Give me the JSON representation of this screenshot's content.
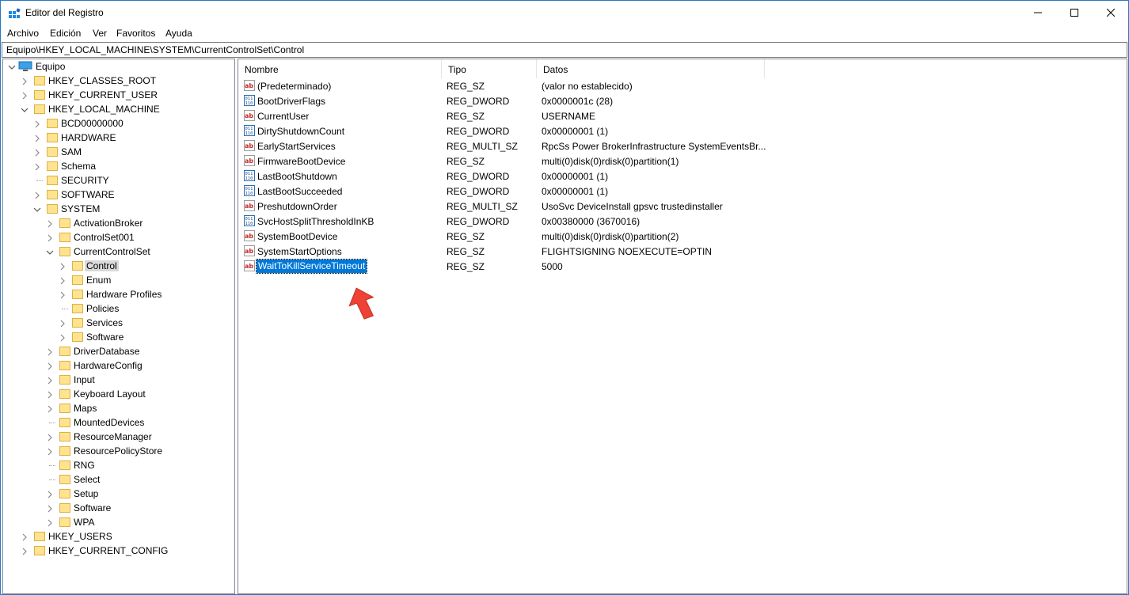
{
  "window": {
    "title": "Editor del Registro",
    "accent_color": "#0078d7"
  },
  "menu": [
    "Archivo",
    "Edición",
    "Ver",
    "Favoritos",
    "Ayuda"
  ],
  "address": "Equipo\\HKEY_LOCAL_MACHINE\\SYSTEM\\CurrentControlSet\\Control",
  "tree": {
    "root": "Equipo",
    "items": [
      {
        "label": "HKEY_CLASSES_ROOT"
      },
      {
        "label": "HKEY_CURRENT_USER"
      },
      {
        "label": "HKEY_LOCAL_MACHINE"
      },
      {
        "label": "BCD00000000"
      },
      {
        "label": "HARDWARE"
      },
      {
        "label": "SAM"
      },
      {
        "label": "Schema"
      },
      {
        "label": "SECURITY"
      },
      {
        "label": "SOFTWARE"
      },
      {
        "label": "SYSTEM"
      },
      {
        "label": "ActivationBroker"
      },
      {
        "label": "ControlSet001"
      },
      {
        "label": "CurrentControlSet"
      },
      {
        "label": "Control"
      },
      {
        "label": "Enum"
      },
      {
        "label": "Hardware Profiles"
      },
      {
        "label": "Policies"
      },
      {
        "label": "Services"
      },
      {
        "label": "Software"
      },
      {
        "label": "DriverDatabase"
      },
      {
        "label": "HardwareConfig"
      },
      {
        "label": "Input"
      },
      {
        "label": "Keyboard Layout"
      },
      {
        "label": "Maps"
      },
      {
        "label": "MountedDevices"
      },
      {
        "label": "ResourceManager"
      },
      {
        "label": "ResourcePolicyStore"
      },
      {
        "label": "RNG"
      },
      {
        "label": "Select"
      },
      {
        "label": "Setup"
      },
      {
        "label": "Software"
      },
      {
        "label": "WPA"
      },
      {
        "label": "HKEY_USERS"
      },
      {
        "label": "HKEY_CURRENT_CONFIG"
      }
    ]
  },
  "list": {
    "headers": {
      "name": "Nombre",
      "type": "Tipo",
      "data": "Datos"
    },
    "rows": [
      {
        "name": "(Predeterminado)",
        "type": "REG_SZ",
        "data": "(valor no establecido)",
        "icon": "string-value-icon"
      },
      {
        "name": "BootDriverFlags",
        "type": "REG_DWORD",
        "data": "0x0000001c (28)",
        "icon": "binary-value-icon"
      },
      {
        "name": "CurrentUser",
        "type": "REG_SZ",
        "data": "USERNAME",
        "icon": "string-value-icon"
      },
      {
        "name": "DirtyShutdownCount",
        "type": "REG_DWORD",
        "data": "0x00000001 (1)",
        "icon": "binary-value-icon"
      },
      {
        "name": "EarlyStartServices",
        "type": "REG_MULTI_SZ",
        "data": "RpcSs Power BrokerInfrastructure SystemEventsBr...",
        "icon": "string-value-icon"
      },
      {
        "name": "FirmwareBootDevice",
        "type": "REG_SZ",
        "data": "multi(0)disk(0)rdisk(0)partition(1)",
        "icon": "string-value-icon"
      },
      {
        "name": "LastBootShutdown",
        "type": "REG_DWORD",
        "data": "0x00000001 (1)",
        "icon": "binary-value-icon"
      },
      {
        "name": "LastBootSucceeded",
        "type": "REG_DWORD",
        "data": "0x00000001 (1)",
        "icon": "binary-value-icon"
      },
      {
        "name": "PreshutdownOrder",
        "type": "REG_MULTI_SZ",
        "data": "UsoSvc DeviceInstall gpsvc trustedinstaller",
        "icon": "string-value-icon"
      },
      {
        "name": "SvcHostSplitThresholdInKB",
        "type": "REG_DWORD",
        "data": "0x00380000 (3670016)",
        "icon": "binary-value-icon"
      },
      {
        "name": "SystemBootDevice",
        "type": "REG_SZ",
        "data": "multi(0)disk(0)rdisk(0)partition(2)",
        "icon": "string-value-icon"
      },
      {
        "name": "SystemStartOptions",
        "type": "REG_SZ",
        "data": " FLIGHTSIGNING  NOEXECUTE=OPTIN",
        "icon": "string-value-icon"
      },
      {
        "name": "WaitToKillServiceTimeout",
        "type": "REG_SZ",
        "data": "5000",
        "icon": "string-value-icon",
        "selected": true
      }
    ]
  }
}
